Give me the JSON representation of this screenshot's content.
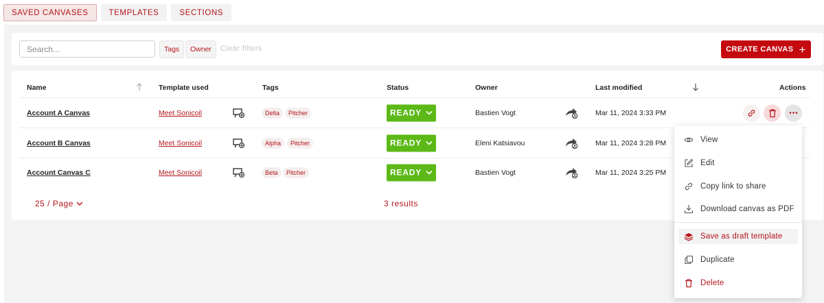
{
  "tabs": [
    {
      "label": "SAVED CANVASES",
      "active": true
    },
    {
      "label": "TEMPLATES",
      "active": false
    },
    {
      "label": "SECTIONS",
      "active": false
    }
  ],
  "filters": {
    "search_placeholder": "Search...",
    "tag_chip": "Tags",
    "owner_chip": "Owner",
    "clear_label": "Clear filters",
    "create_label": "CREATE CANVAS",
    "create_icon": "plus-icon"
  },
  "table": {
    "headers": {
      "name": "Name",
      "template": "Template used",
      "tags": "Tags",
      "status": "Status",
      "owner": "Owner",
      "modified": "Last modified",
      "actions": "Actions"
    },
    "rows": [
      {
        "name": "Account A Canvas",
        "template": "Meet Sonicoil",
        "tags": [
          "Delta",
          "Pitcher"
        ],
        "status": "READY",
        "owner": "Bastien Vogt",
        "modified": "Mar 11, 2024 3:33 PM"
      },
      {
        "name": "Account B Canvas",
        "template": "Meet Sonicoil",
        "tags": [
          "Alpha",
          "Pitcher"
        ],
        "status": "READY",
        "owner": "Eleni Katsiavou",
        "modified": "Mar 11, 2024 3:28 PM"
      },
      {
        "name": "Account Canvas C",
        "template": "Meet Sonicoil",
        "tags": [
          "Beta",
          "Pitcher"
        ],
        "status": "READY",
        "owner": "Bastien Vogt",
        "modified": "Mar 11, 2024 3:25 PM"
      }
    ],
    "page_size": "25 / Page",
    "results": "3 results"
  },
  "menu": {
    "items": [
      {
        "label": "View",
        "icon": "eye-icon"
      },
      {
        "label": "Edit",
        "icon": "edit-icon"
      },
      {
        "label": "Copy link to share",
        "icon": "link-icon"
      },
      {
        "label": "Download canvas as PDF",
        "icon": "download-icon"
      },
      {
        "label": "Save as draft template",
        "icon": "layers-icon"
      },
      {
        "label": "Duplicate",
        "icon": "copy-icon"
      },
      {
        "label": "Delete",
        "icon": "trash-icon"
      }
    ]
  },
  "colors": {
    "brand_red": "#c4090f",
    "status_green": "#5cb917",
    "panel_bg": "#f3f3f3"
  }
}
